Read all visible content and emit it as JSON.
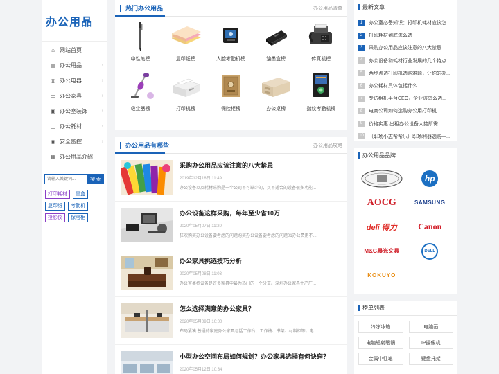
{
  "logo": {
    "text": "办公用品"
  },
  "nav": [
    {
      "label": "网站首页",
      "icon": "home-icon",
      "glyph": "⌂",
      "arrow": ""
    },
    {
      "label": "办公用品",
      "icon": "document-icon",
      "glyph": "▤",
      "arrow": "›"
    },
    {
      "label": "办公电器",
      "icon": "appliance-icon",
      "glyph": "◎",
      "arrow": "›"
    },
    {
      "label": "办公家具",
      "icon": "furniture-icon",
      "glyph": "▭",
      "arrow": "›"
    },
    {
      "label": "办公室装饰",
      "icon": "decoration-icon",
      "glyph": "▣",
      "arrow": "›"
    },
    {
      "label": "办公耗材",
      "icon": "consumable-icon",
      "glyph": "◫",
      "arrow": "›"
    },
    {
      "label": "安全监控",
      "icon": "security-icon",
      "glyph": "◉",
      "arrow": "›"
    },
    {
      "label": "办公用品介绍",
      "icon": "intro-icon",
      "glyph": "▦",
      "arrow": ""
    }
  ],
  "search": {
    "placeholder": "请输入关键词...",
    "button": "搜 索"
  },
  "tags": [
    "打印耗材",
    "墨盒",
    "复印纸",
    "考勤机",
    "投影仪",
    "保险柜"
  ],
  "hot": {
    "title": "热门办公用品",
    "more": "办公用品清单",
    "items": [
      {
        "label": "中性笔榜",
        "icon": "pen-icon"
      },
      {
        "label": "复印纸榜",
        "icon": "paper-icon"
      },
      {
        "label": "人脸考勤机榜",
        "icon": "face-attendance-icon"
      },
      {
        "label": "油墨盒榜",
        "icon": "ink-cartridge-icon"
      },
      {
        "label": "传真机榜",
        "icon": "fax-icon"
      },
      {
        "label": "吸尘器榜",
        "icon": "vacuum-icon"
      },
      {
        "label": "打印机榜",
        "icon": "printer-icon"
      },
      {
        "label": "保险柜榜",
        "icon": "safe-icon"
      },
      {
        "label": "办公桌榜",
        "icon": "desk-icon"
      },
      {
        "label": "指纹考勤机榜",
        "icon": "fingerprint-icon"
      }
    ]
  },
  "articles_panel": {
    "title": "办公用品有哪些",
    "more": "办公用品攻略",
    "items": [
      {
        "title": "采购办公用品应该注意的八大禁忌",
        "date": "2019年12月18日 11:49",
        "snippet": "办公设备以及耗材采购是一个公司不可缺少的，买不适合的设备很多功能...",
        "thumb": "stationery-thumb"
      },
      {
        "title": "办公设备这样采购，每年至少省10万",
        "date": "2020年05月07日 11:20",
        "snippet": "狂欢购买办公设备要考虑的问题购买办公设备要考虑的问题01办公费用不...",
        "thumb": "office-desk-thumb"
      },
      {
        "title": "办公家具挑选技巧分析",
        "date": "2020年05月08日 11:03",
        "snippet": "办公室桌椅设备是许多家具中最为热门的一个分支。深圳办公家具生产厂...",
        "thumb": "executive-office-thumb"
      },
      {
        "title": "怎么选择满意的办公家具？",
        "date": "2020年05月09日 10:00",
        "snippet": "布局紧凑 普通的家庭办公家具包括工作台、工作椅、书架、材料柜等。电...",
        "thumb": "workstation-thumb"
      },
      {
        "title": "小型办公空间布局如何规划？办公家具选择有何诀窍？",
        "date": "2020年05月12日 10:34",
        "snippet": "",
        "thumb": "small-office-thumb"
      }
    ]
  },
  "latest": {
    "title": "最新文章",
    "items": [
      "办公室必备知识：打印机耗材应该怎...",
      "打印耗材到底怎么选",
      "采购办公用品应该注意的八大禁忌",
      "办公设备和耗材行业发展的几个特点...",
      "两步点透打印机选购难题，让你的办...",
      "办公耗材具体包括什么",
      "专访租机平台CEO，企业该怎么选...",
      "电商公司如何选购办公用打印机",
      "价格实惠 出租办公设备大势所需",
      "（职场小志帮帮乐）职场利器选购—..."
    ]
  },
  "brands": {
    "title": "办公用品品牌",
    "items": [
      {
        "name": "",
        "logo": "crest-brand-logo"
      },
      {
        "name": "hp",
        "color": "#1b6fc2"
      },
      {
        "name": "AOCG",
        "color": "#d0202a"
      },
      {
        "name": "SAMSUNG",
        "color": "#1a3e8c"
      },
      {
        "name": "deli 得力",
        "color": "#e0302b"
      },
      {
        "name": "Canon",
        "color": "#d21f2a"
      },
      {
        "name": "M&G晨光文具",
        "color": "#d0202a"
      },
      {
        "name": "DELL",
        "color": "#1b6fc2"
      },
      {
        "name": "KOKUYO",
        "color": "#e88c12"
      }
    ]
  },
  "ranks": {
    "title": "榜单列表",
    "items": [
      "冷冻冰箱",
      "电脑画",
      "电脑辐射眼镜",
      "IP摄像机",
      "金属中性笔",
      "键盘托架"
    ]
  }
}
